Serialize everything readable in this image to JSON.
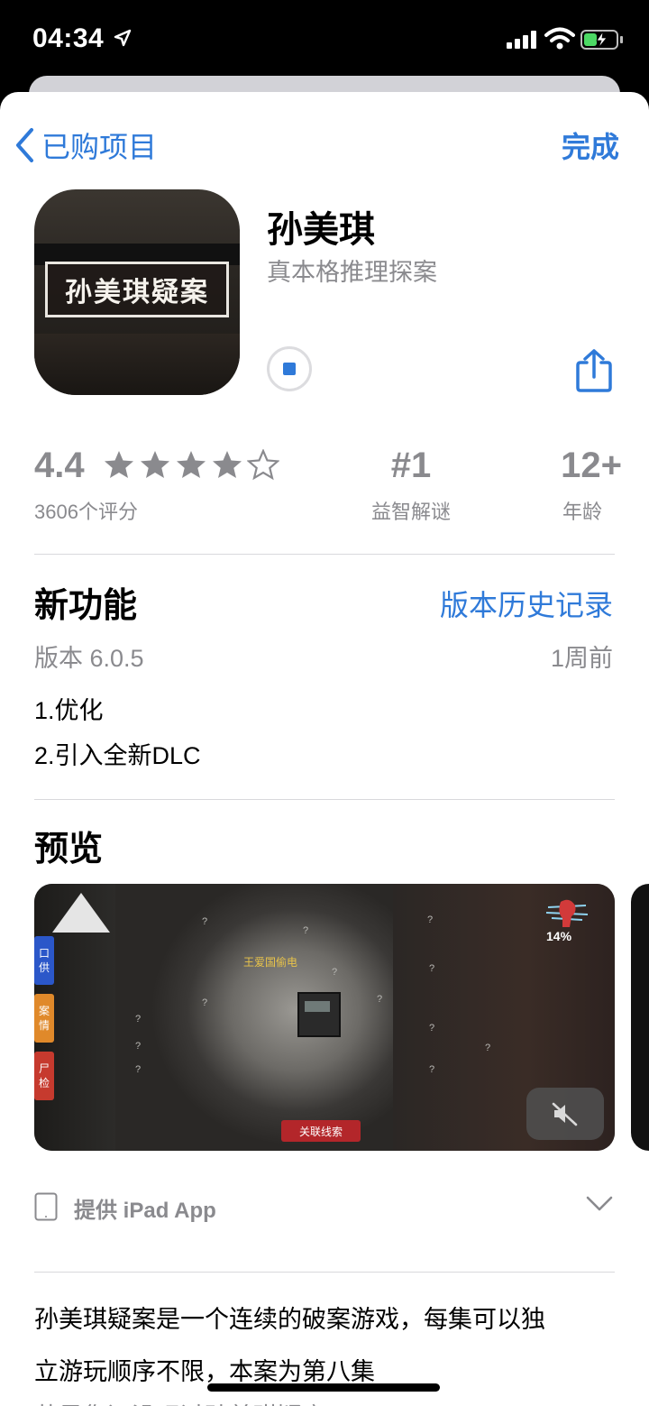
{
  "status_bar": {
    "time": "04:34"
  },
  "nav": {
    "back_label": "已购项目",
    "done_label": "完成"
  },
  "app": {
    "icon_text": "孙美琪疑案",
    "title": "孙美琪",
    "subtitle": "真本格推理探案"
  },
  "stats": {
    "rating": "4.4",
    "stars": 4.4,
    "rating_count": "3606个评分",
    "rank": "#1",
    "rank_category": "益智解谜",
    "age": "12+",
    "age_label": "年龄"
  },
  "whats_new": {
    "title": "新功能",
    "history_link": "版本历史记录",
    "version": "版本 6.0.5",
    "date": "1周前",
    "notes": [
      "1.优化",
      "2.引入全新DLC"
    ]
  },
  "preview": {
    "title": "预览",
    "screenshot": {
      "tabs": [
        {
          "text": "口\n供",
          "color": "#2b57c9"
        },
        {
          "text": "案\n情",
          "color": "#e0892a"
        },
        {
          "text": "尸\n检",
          "color": "#c63a2e"
        }
      ],
      "label": "王爱国偷电",
      "button": "关联线索",
      "percent": "14%"
    }
  },
  "ipad": {
    "label": "提供 iPad App"
  },
  "description": {
    "lines": [
      "孙美琪疑案是一个连续的破案游戏，每集可以独",
      "立游玩顺序不限，本案为第八集",
      "若是您还没玩过孙美琪疑案"
    ]
  },
  "colors": {
    "accent": "#2f7ad9",
    "secondary_text": "#8a8a8e"
  }
}
